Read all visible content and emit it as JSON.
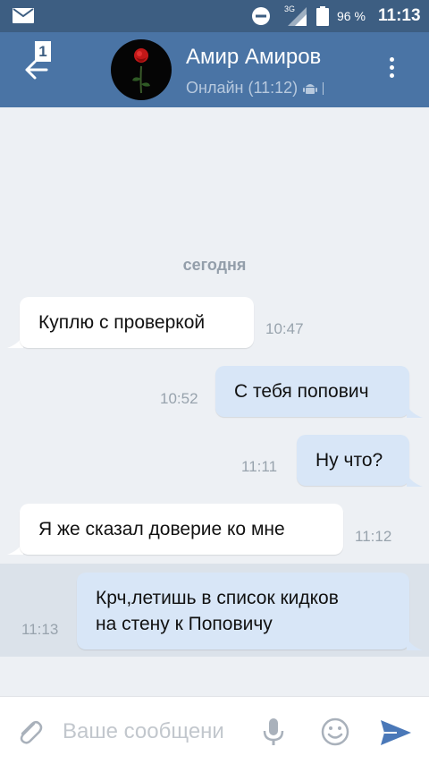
{
  "status_bar": {
    "network": "3G",
    "battery_percent": "96 %",
    "time": "11:13"
  },
  "header": {
    "unread_count": "1",
    "contact_name": "Амир Амиров",
    "contact_status": "Онлайн (11:12)"
  },
  "chat": {
    "date_separator": "сегодня",
    "messages": [
      {
        "direction": "in",
        "text": "Куплю с проверкой",
        "time": "10:47"
      },
      {
        "direction": "out",
        "text": "С тебя попович",
        "time": "10:52"
      },
      {
        "direction": "out",
        "text": "Ну что?",
        "time": "11:11"
      },
      {
        "direction": "in",
        "text": "Я же сказал доверие ко мне",
        "time": "11:12"
      },
      {
        "direction": "out",
        "text": "Крч,летишь в список кидков",
        "text_line2": "на стену к Поповичу",
        "time": "11:13"
      }
    ]
  },
  "composer": {
    "placeholder": "Ваше сообщени"
  },
  "colors": {
    "header_bg": "#4a74a5",
    "status_bar_bg": "#3d5e82",
    "incoming_bubble": "#ffffff",
    "outgoing_bubble": "#d8e6f7",
    "send_icon": "#4a78b8"
  },
  "icons": [
    "mail-icon",
    "do-not-disturb-icon",
    "signal-icon",
    "battery-icon",
    "back-arrow-icon",
    "android-icon",
    "more-vert-icon",
    "attach-icon",
    "mic-icon",
    "emoji-icon",
    "send-icon",
    "rose-avatar"
  ]
}
